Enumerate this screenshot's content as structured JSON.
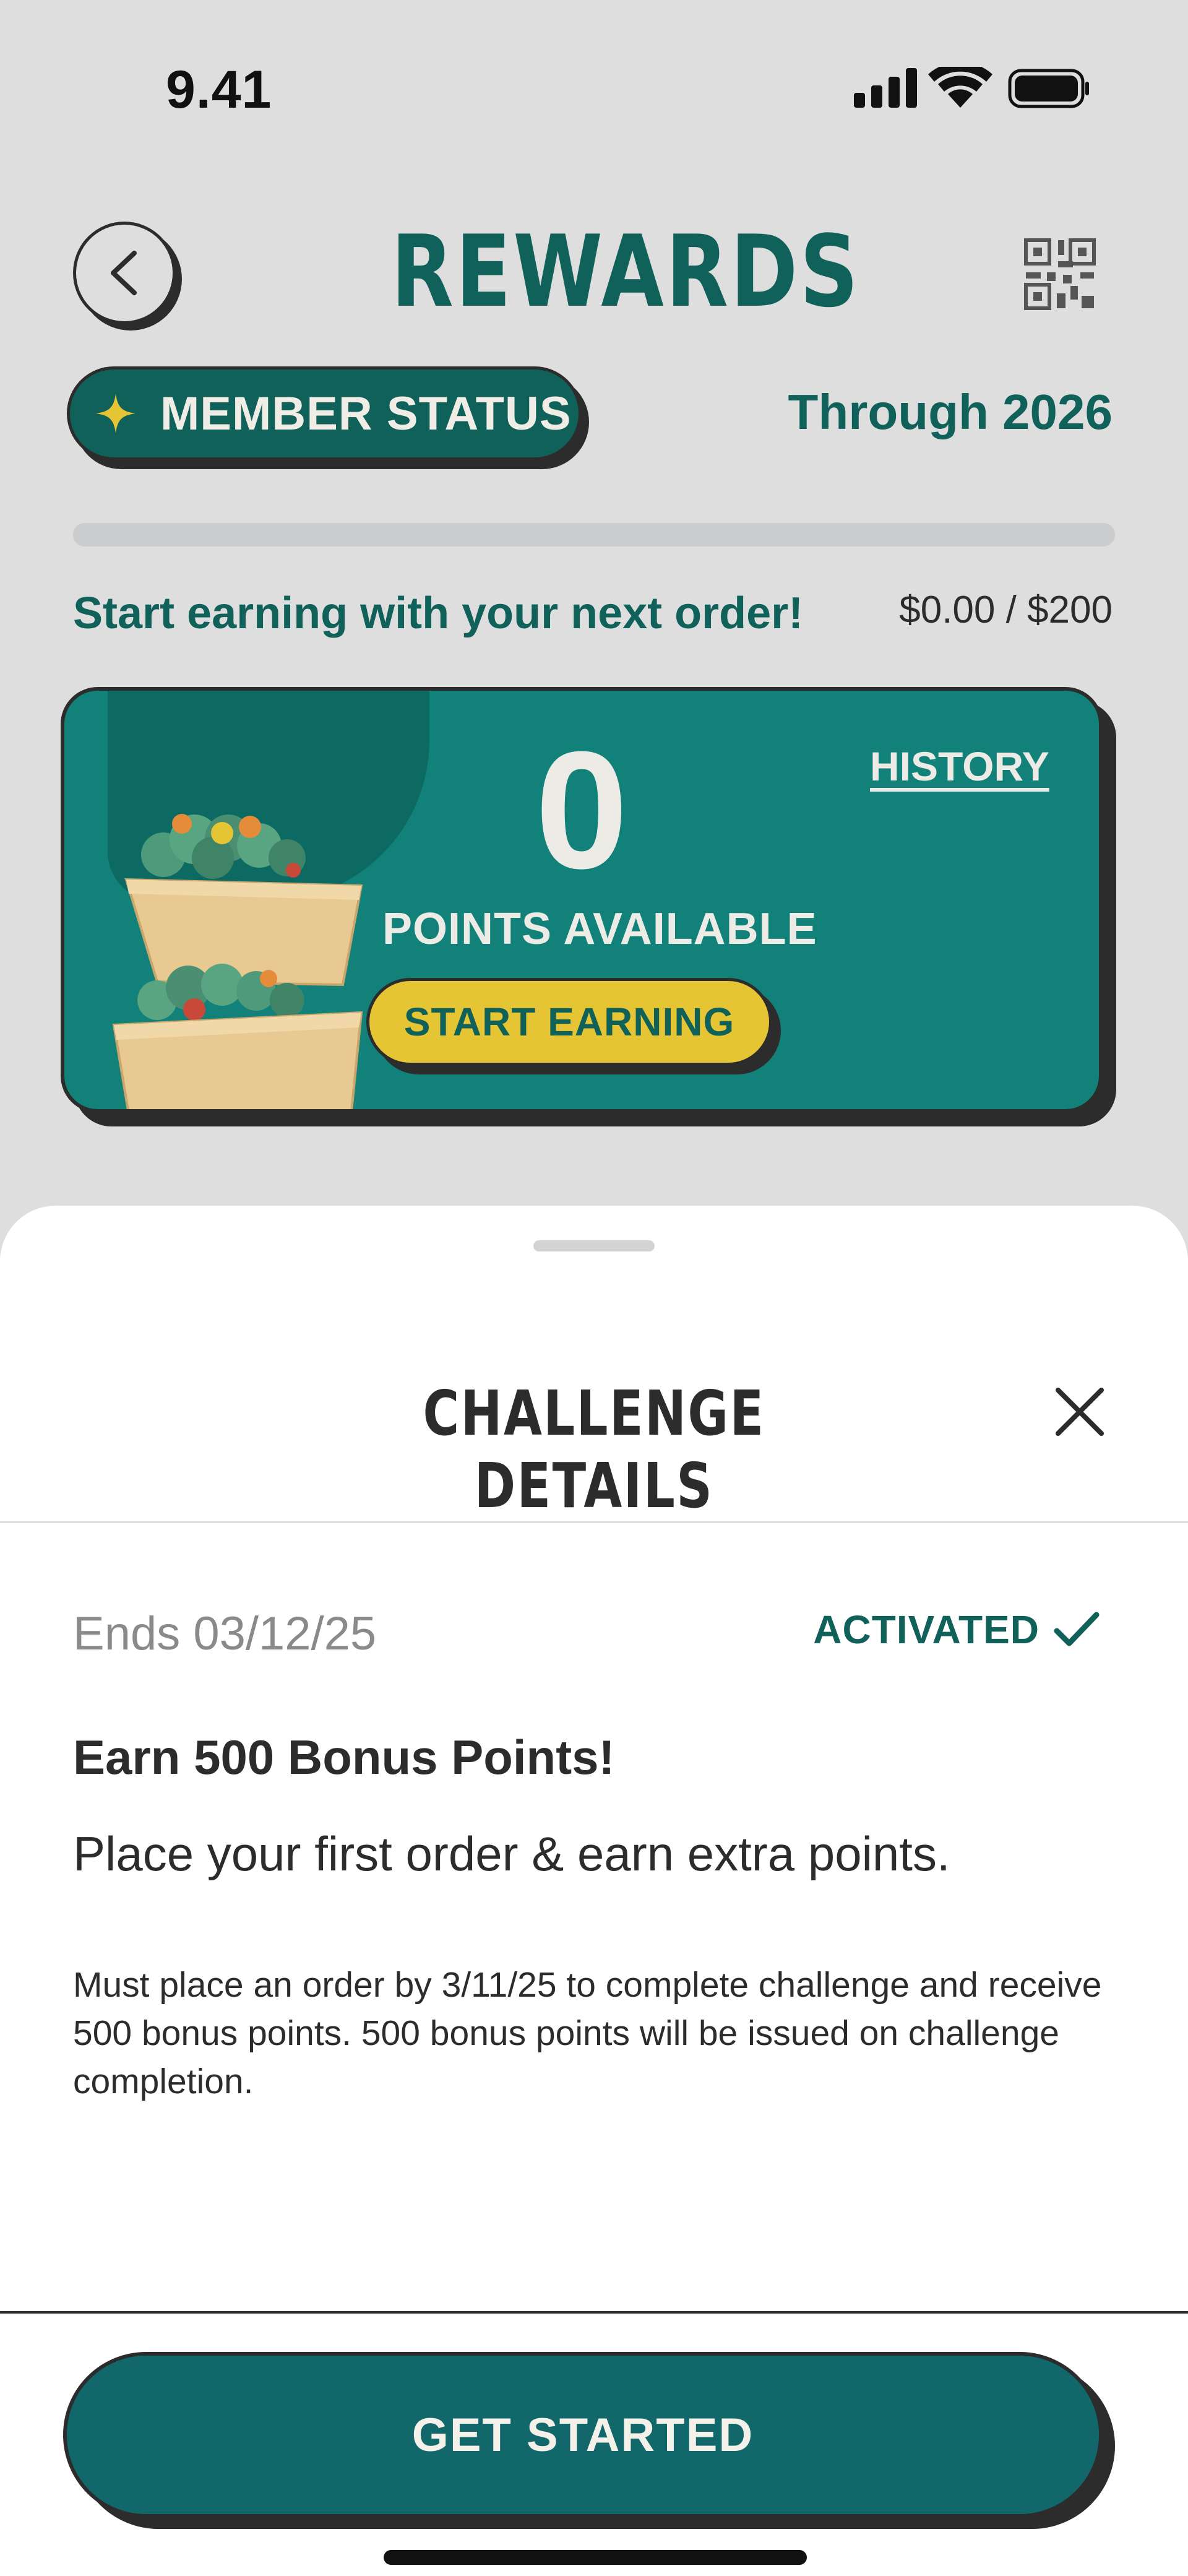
{
  "status_bar": {
    "time": "9.41"
  },
  "header": {
    "title": "REWARDS"
  },
  "member": {
    "status_label": "MEMBER STATUS",
    "through_text": "Through 2026",
    "progress_message": "Start earning with your next order!",
    "progress_amount": "$0.00 / $200",
    "progress_fraction": 0.0
  },
  "points_card": {
    "points_value": "0",
    "points_label": "POINTS AVAILABLE",
    "history_label": "HISTORY",
    "start_button_label": "START EARNING"
  },
  "sheet": {
    "title": "CHALLENGE DETAILS",
    "ends_text": "Ends 03/12/25",
    "status_text": "ACTIVATED",
    "challenge_title": "Earn 500 Bonus Points!",
    "challenge_subtitle": "Place your first order & earn extra points.",
    "challenge_terms": "Must place an order by 3/11/25 to complete challenge and receive 500 bonus points. 500 bonus points will be issued on challenge completion.",
    "cta_label": "GET STARTED"
  },
  "icons": {
    "back": "chevron-left-icon",
    "qr": "qr-code-icon",
    "star": "sparkle-icon",
    "close": "close-icon",
    "check": "check-icon"
  },
  "colors": {
    "brand_green": "#11615b",
    "card_teal": "#11817a",
    "accent_yellow": "#e6c534",
    "background": "#dededf"
  }
}
